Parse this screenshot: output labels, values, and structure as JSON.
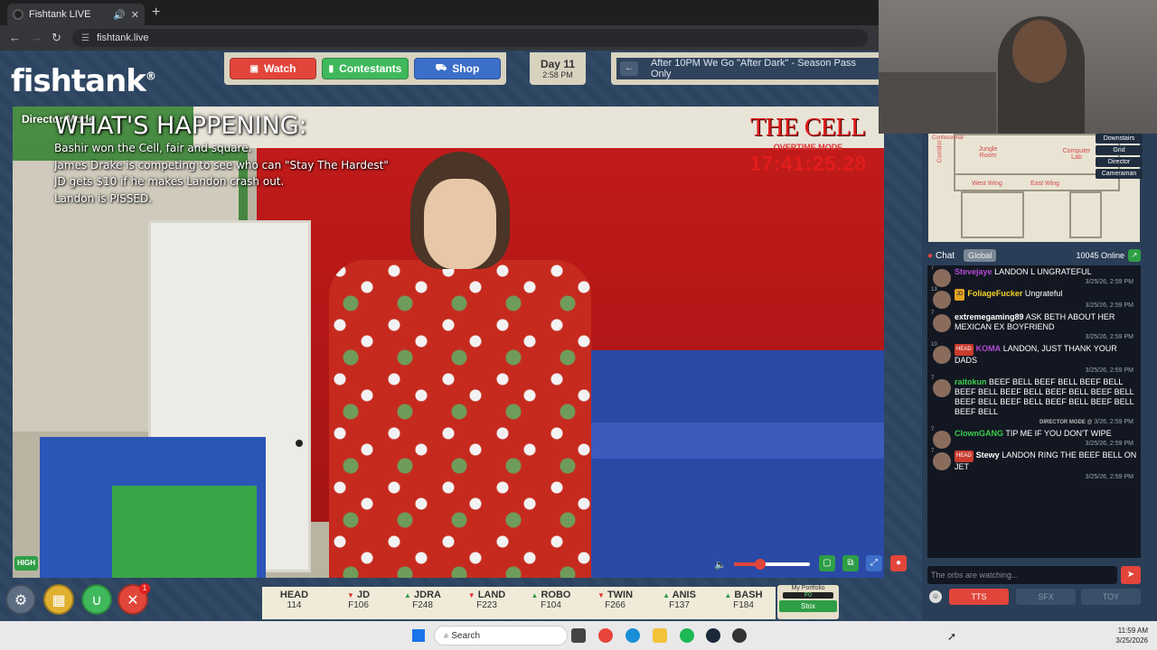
{
  "browser": {
    "tab_title": "Fishtank LIVE",
    "url": "fishtank.live"
  },
  "site": {
    "logo": "fishtank",
    "nav": {
      "watch": "Watch",
      "contestants": "Contestants",
      "shop": "Shop"
    },
    "day": {
      "label": "Day 11",
      "time": "2:58 PM"
    },
    "ticker_text": "After 10PM We Go \"After Dark\" - Season Pass Only"
  },
  "video": {
    "mode_label": "Director Mode",
    "whats_happening_title": "WHAT'S HAPPENING:",
    "whats_happening_lines": [
      "Bashir won the Cell, fair and square.",
      "James Drake is competing to see who can \"Stay The Hardest\"",
      "JD gets $10 if he makes Landon crash out.",
      "Landon is PISSED."
    ],
    "room_name": "THE CELL",
    "room_mode": "OVERTIME MODE",
    "room_timer": "17:41:25.28",
    "quality_badge": "HIGH",
    "volume_level": 0.35
  },
  "bottom_buttons": {
    "notification_count": "1"
  },
  "stocks": [
    {
      "name": "HEAD",
      "value": "114",
      "dir": "none"
    },
    {
      "name": "JD",
      "value": "F106",
      "dir": "down"
    },
    {
      "name": "JDRA",
      "value": "F248",
      "dir": "up"
    },
    {
      "name": "LAND",
      "value": "F223",
      "dir": "down"
    },
    {
      "name": "ROBO",
      "value": "F104",
      "dir": "up"
    },
    {
      "name": "TWIN",
      "value": "F266",
      "dir": "down"
    },
    {
      "name": "ANIS",
      "value": "F137",
      "dir": "up"
    },
    {
      "name": "BASH",
      "value": "F184",
      "dir": "up"
    }
  ],
  "portfolio": {
    "label": "My Portfolio",
    "value": "F0",
    "button": "Stox"
  },
  "map": {
    "rooms": [
      "Jungle Room",
      "Computer Lab",
      "West Wing",
      "East Wing",
      "Corridor",
      "Confessional"
    ],
    "buttons": [
      "Downstairs",
      "Grid",
      "Director",
      "Cameraman"
    ]
  },
  "chat": {
    "title": "Chat",
    "channel": "Global",
    "online": "10045 Online",
    "messages": [
      {
        "user": "Stevejaye",
        "text": "LANDON L UNGRATEFUL",
        "time": "3/25/26, 2:59 PM",
        "user_color": "#b44ad6",
        "badge": "",
        "level": "7"
      },
      {
        "user": "FoliageFucker",
        "text": "Ungrateful",
        "time": "3/25/26, 2:59 PM",
        "user_color": "#f5d328",
        "badge": "JD",
        "level": "13"
      },
      {
        "user": "extremegaming89",
        "text": "ASK BETH ABOUT HER MEXICAN EX BOYFRIEND",
        "time": "3/25/26, 2:59 PM",
        "user_color": "#ffffff",
        "badge": "",
        "level": "7"
      },
      {
        "user": "KOMA",
        "text": "LANDON, JUST THANK YOUR DADS",
        "time": "3/25/26, 2:59 PM",
        "user_color": "#b44ad6",
        "badge": "HEAD",
        "level": "10"
      },
      {
        "user": "raitokun",
        "text": "BEEF BELL BEEF BELL BEEF BELL BEEF BELL BEEF BELL BEEF BELL BEEF BELL BEEF BELL BEEF BELL BEEF BELL BEEF BELL BEEF BELL",
        "time": "3/26, 2:59 PM",
        "user_color": "#3fcf4f",
        "badge": "",
        "level": "7",
        "director": "DIRECTOR MODE @"
      },
      {
        "user": "ClownGANG",
        "text": "TIP ME IF YOU DON'T WIPE",
        "time": "3/25/26, 2:59 PM",
        "user_color": "#3fcf4f",
        "badge": "",
        "level": "7"
      },
      {
        "user": "Stewy",
        "text": "LANDON RING THE BEEF BELL ON JET",
        "time": "3/25/26, 2:59 PM",
        "user_color": "#ffffff",
        "badge": "HEAD",
        "level": "7"
      }
    ],
    "input_placeholder": "The orbs are watching...",
    "buttons": {
      "tts": "TTS",
      "sfx": "SFX",
      "toy": "TOY"
    }
  },
  "taskbar": {
    "search": "Search",
    "time": "11:59 AM",
    "date": "3/25/2026"
  }
}
